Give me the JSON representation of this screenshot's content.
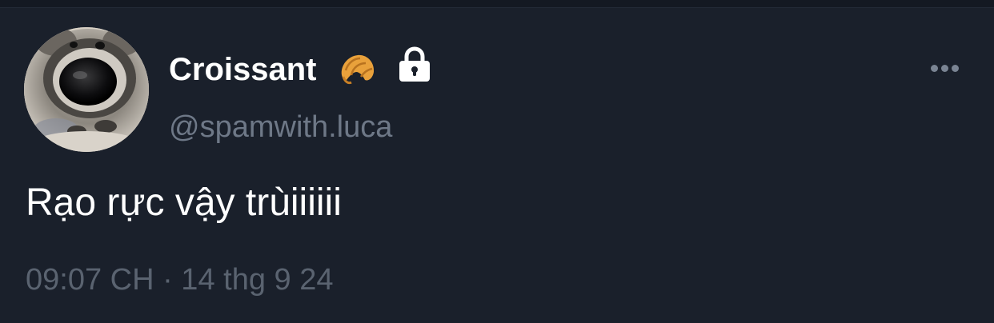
{
  "post": {
    "author": {
      "display_name": "Croissant",
      "handle": "@spamwith.luca",
      "avatar_icon": "raccoon-avatar",
      "name_emoji_icon": "croissant-icon",
      "badge_icon": "lock-icon"
    },
    "text": "Rạo rực vậy trùiiiiii",
    "timestamp": "09:07 CH · 14 thg 9 24",
    "menu_icon": "more-options-icon"
  },
  "colors": {
    "background": "#1a202b",
    "primary_text": "#ffffff",
    "secondary_text": "#6e7887",
    "timestamp_text": "#5a6370"
  }
}
